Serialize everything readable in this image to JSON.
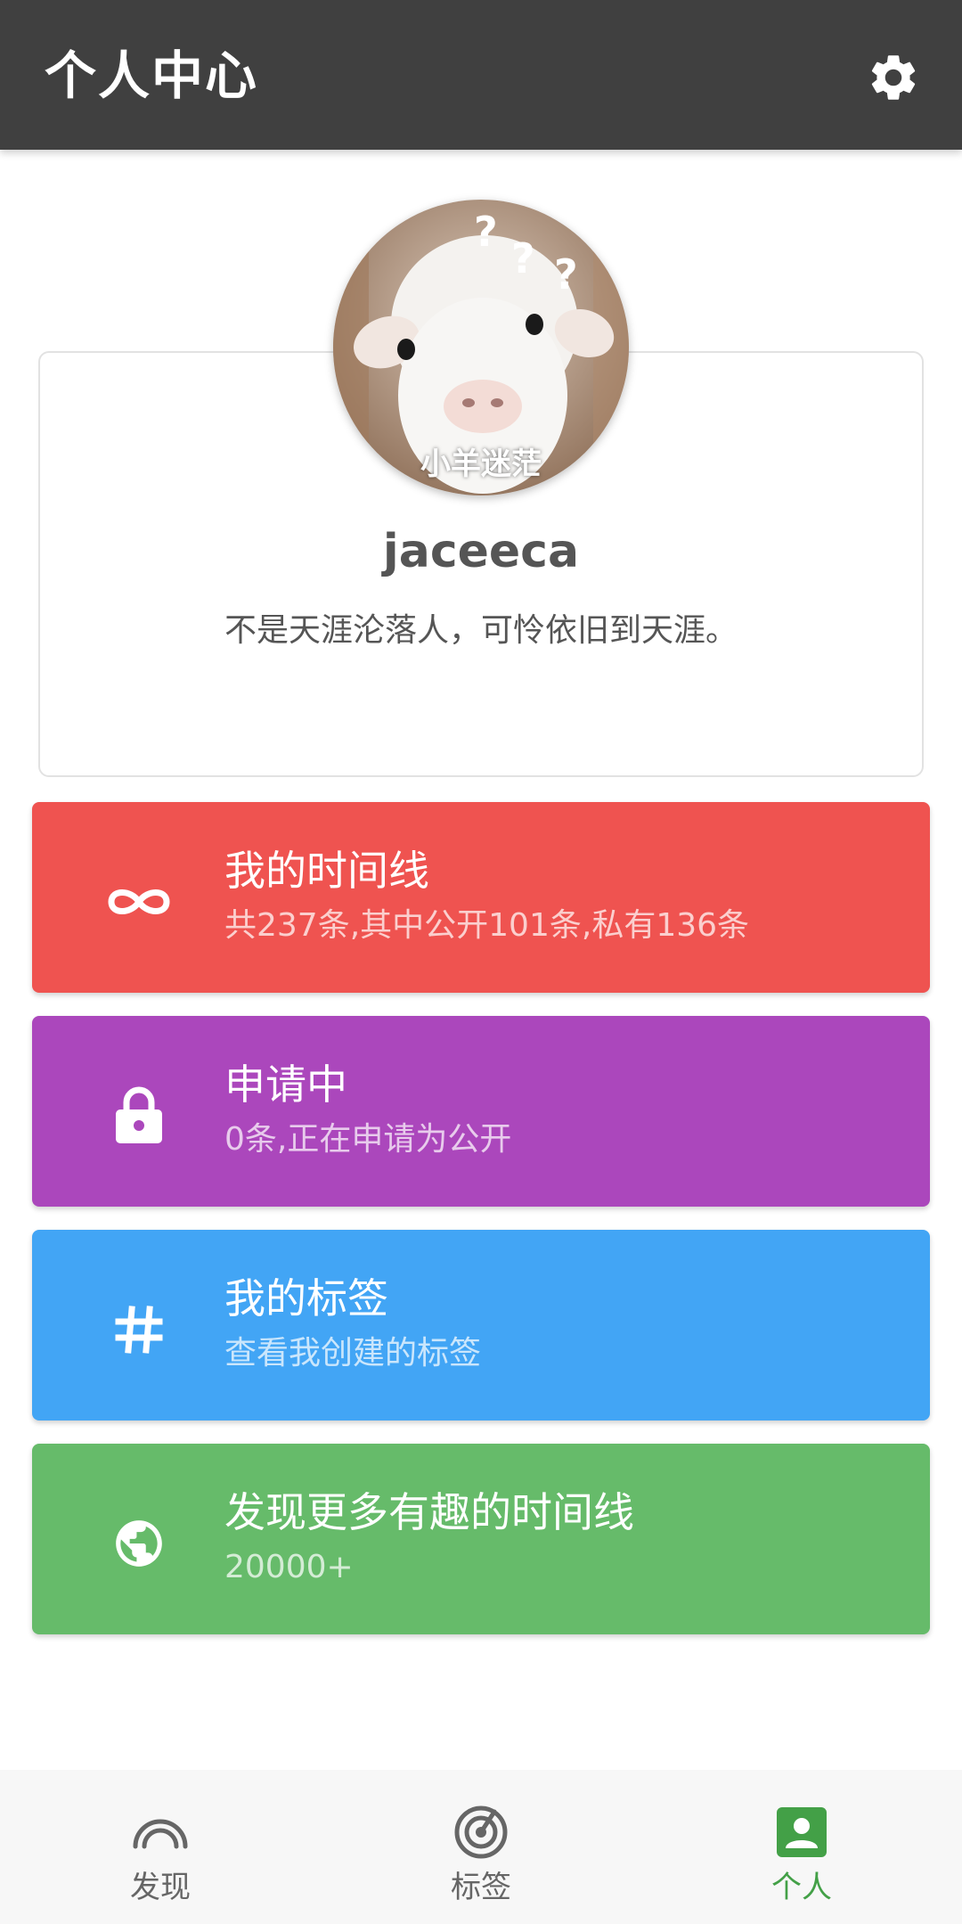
{
  "header": {
    "title": "个人中心",
    "settings_icon": "gear-icon"
  },
  "profile": {
    "avatar_caption": "小羊迷茫",
    "username": "jaceeca",
    "bio": "不是天涯沦落人，可怜依旧到天涯。"
  },
  "menu": [
    {
      "title": "我的时间线",
      "subtitle": "共237条,其中公开101条,私有136条",
      "icon": "infinity-icon",
      "color": "#ef5350"
    },
    {
      "title": "申请中",
      "subtitle": "0条,正在申请为公开",
      "icon": "lock-icon",
      "color": "#ab47bc"
    },
    {
      "title": "我的标签",
      "subtitle": "查看我创建的标签",
      "icon": "hash-icon",
      "color": "#42a5f5"
    },
    {
      "title": "发现更多有趣的时间线",
      "subtitle": "20000+",
      "icon": "globe-icon",
      "color": "#66bb6a"
    }
  ],
  "bottom_nav": {
    "items": [
      {
        "label": "发现",
        "icon": "discover-icon"
      },
      {
        "label": "标签",
        "icon": "radar-icon"
      },
      {
        "label": "个人",
        "icon": "person-icon"
      }
    ],
    "active_index": 2,
    "active_color": "#43a047",
    "inactive_color": "#666666"
  }
}
